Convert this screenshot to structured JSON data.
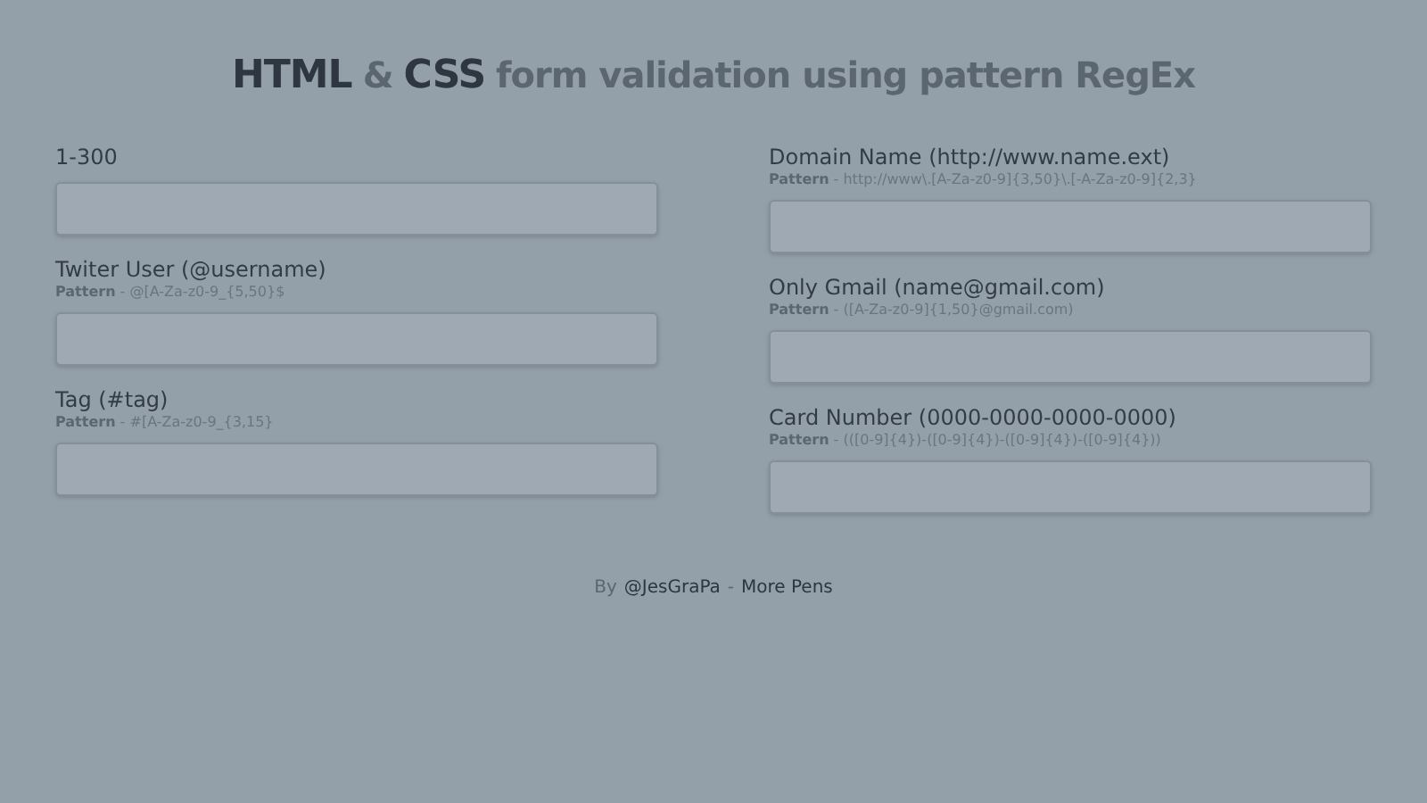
{
  "title": [
    {
      "text": "HTML",
      "kind": "strong"
    },
    {
      "text": "&",
      "kind": "muted"
    },
    {
      "text": "CSS",
      "kind": "strong"
    },
    {
      "text": "form validation using pattern RegEx",
      "kind": "muted"
    }
  ],
  "columns": [
    {
      "fields": [
        {
          "label": "1-300"
        },
        {
          "label": "Twiter User (@username)",
          "pattern": "**Pattern** - @[A-Za-z0-9_{5,50}$"
        },
        {
          "label": "Tag (#tag)",
          "pattern": "**Pattern** - #[A-Za-z0-9_{3,15}"
        }
      ]
    },
    {
      "fields": [
        {
          "label": "Domain Name (http://www.name.ext)",
          "pattern": "**Pattern** - http://www\\.[A-Za-z0-9]{3,50}\\.[-A-Za-z0-9]{2,3}"
        },
        {
          "label": "Only Gmail (name@gmail.com)",
          "pattern": "**Pattern** - ([A-Za-z0-9]{1,50}@gmail.com)"
        },
        {
          "label": "Card Number (0000-0000-0000-0000)",
          "pattern": "**Pattern** - (([0-9]{4})-([0-9]{4})-([0-9]{4})-([0-9]{4}))"
        }
      ]
    }
  ],
  "footer": [
    {
      "text": "By",
      "kind": "text"
    },
    {
      "text": "@JesGraPa",
      "kind": "link"
    },
    {
      "text": "-",
      "kind": "text"
    },
    {
      "text": "More Pens",
      "kind": "link"
    }
  ]
}
